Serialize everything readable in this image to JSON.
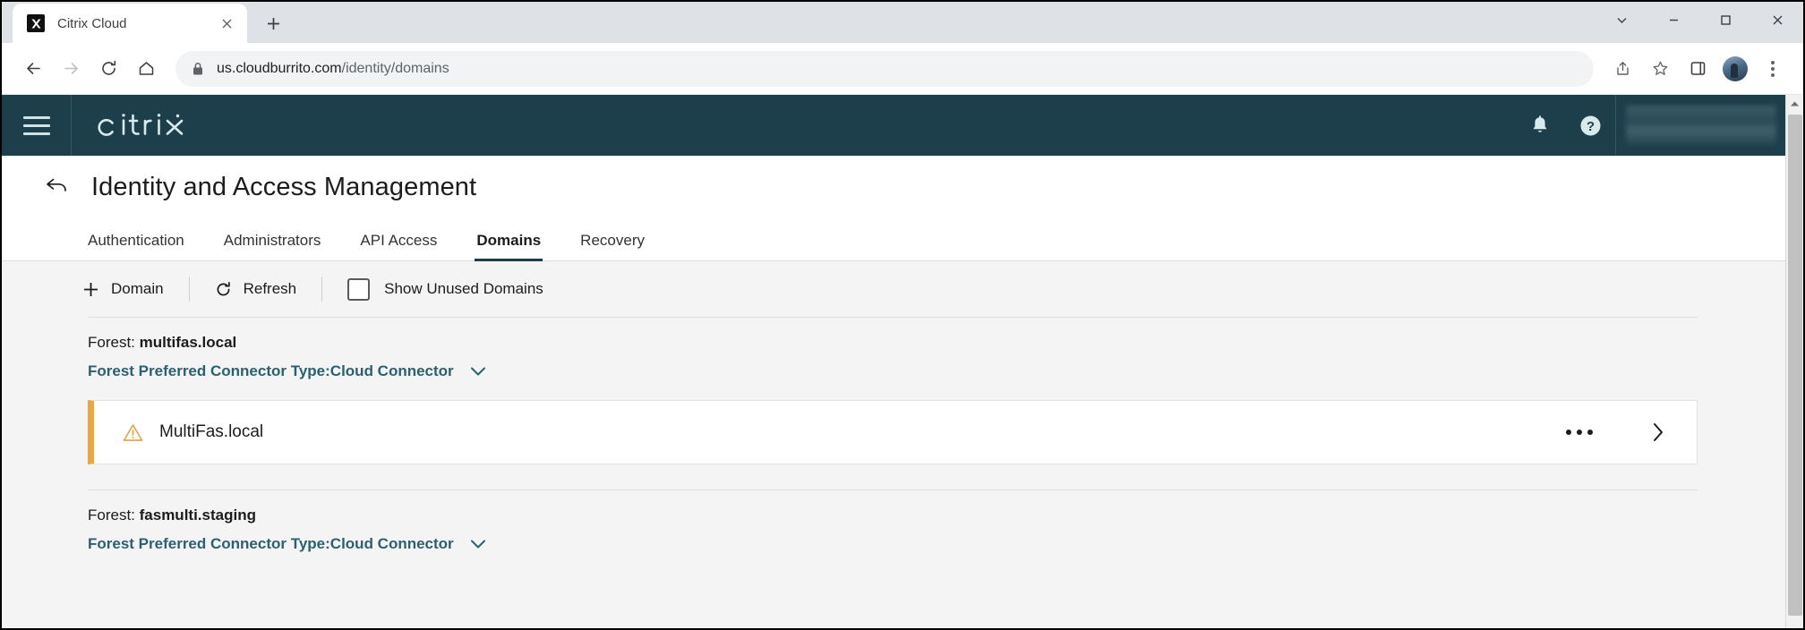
{
  "browser": {
    "tab": {
      "title": "Citrix Cloud",
      "favicon": "citrix-x-favicon",
      "close_label": "×"
    },
    "new_tab_label": "+",
    "window_controls": {
      "expand": "expand-icon",
      "minimize": "minimize-icon",
      "maximize": "maximize-icon",
      "close": "close-icon"
    },
    "nav": {
      "back": "back-icon",
      "forward": "forward-icon",
      "reload": "reload-icon",
      "home": "home-icon"
    },
    "omnibox": {
      "lock": "lock-icon",
      "host": "us.cloudburrito.com",
      "path": "/identity/domains",
      "full_url": "us.cloudburrito.com/identity/domains"
    },
    "toolbar_icons": [
      "share-icon",
      "bookmark-star-icon",
      "side-panel-icon",
      "profile-avatar",
      "more-menu-icon"
    ]
  },
  "app_header": {
    "menu_icon": "hamburger-menu-icon",
    "logo_text": "citrix",
    "notifications_icon": "bell-icon",
    "help_icon": "help-question-icon",
    "account_label": ""
  },
  "page": {
    "back_icon": "back-arrow-icon",
    "title": "Identity and Access Management",
    "tabs": [
      {
        "label": "Authentication",
        "active": false
      },
      {
        "label": "Administrators",
        "active": false
      },
      {
        "label": "API Access",
        "active": false
      },
      {
        "label": "Domains",
        "active": true
      },
      {
        "label": "Recovery",
        "active": false
      }
    ],
    "toolbar": {
      "add_domain": {
        "icon": "plus-icon",
        "label": "Domain"
      },
      "refresh": {
        "icon": "refresh-icon",
        "label": "Refresh"
      },
      "show_unused": {
        "label": "Show Unused Domains",
        "checked": false
      }
    },
    "forests": [
      {
        "prefix": "Forest: ",
        "name": "multifas.local",
        "connector_label": "Forest Preferred Connector Type:Cloud Connector",
        "chevron": "chevron-down-icon",
        "domains": [
          {
            "status_icon": "warning-triangle-icon",
            "name": "MultiFas.local",
            "more_icon": "more-horizontal-icon",
            "detail_icon": "chevron-right-icon",
            "accent_color": "#e3a84d"
          }
        ]
      },
      {
        "prefix": "Forest: ",
        "name": "fasmulti.staging",
        "connector_label": "Forest Preferred Connector Type:Cloud Connector",
        "chevron": "chevron-down-icon",
        "domains": []
      }
    ]
  },
  "colors": {
    "header_teal": "#1d3e4b",
    "link_teal": "#2b6072",
    "warning_orange": "#e3a84d",
    "page_bg": "#f4f4f4"
  },
  "scrollbar": {
    "up_arrow": "scroll-up-arrow-icon"
  }
}
